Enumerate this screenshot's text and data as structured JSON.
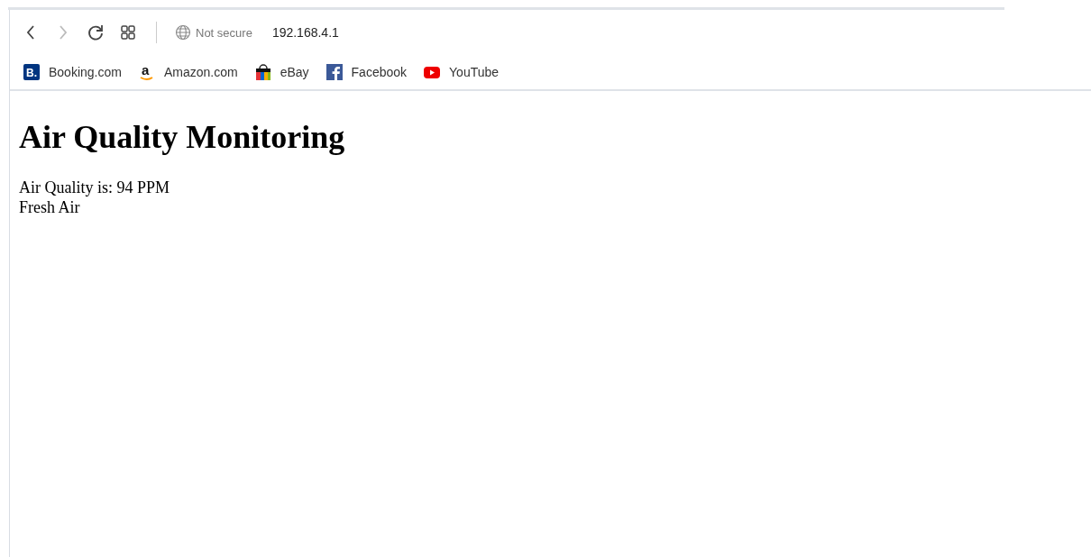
{
  "toolbar": {
    "nav_buttons": [
      {
        "kind": "back",
        "disabled": false
      },
      {
        "kind": "forward",
        "disabled": true
      },
      {
        "kind": "reload",
        "disabled": false
      },
      {
        "kind": "apps",
        "disabled": false
      }
    ],
    "security": "Not secure",
    "url": "192.168.4.1"
  },
  "bookmarks": [
    {
      "kind": "booking",
      "logo": "B.",
      "label": "Booking.com"
    },
    {
      "kind": "amazon",
      "logo": "a",
      "label": "Amazon.com"
    },
    {
      "kind": "ebay",
      "label": "eBay"
    },
    {
      "kind": "facebook",
      "label": "Facebook"
    },
    {
      "kind": "youtube",
      "label": "YouTube"
    }
  ],
  "page": {
    "heading": "Air Quality Monitoring",
    "lines": [
      "Air Quality is: 94 PPM",
      "Fresh Air"
    ]
  }
}
